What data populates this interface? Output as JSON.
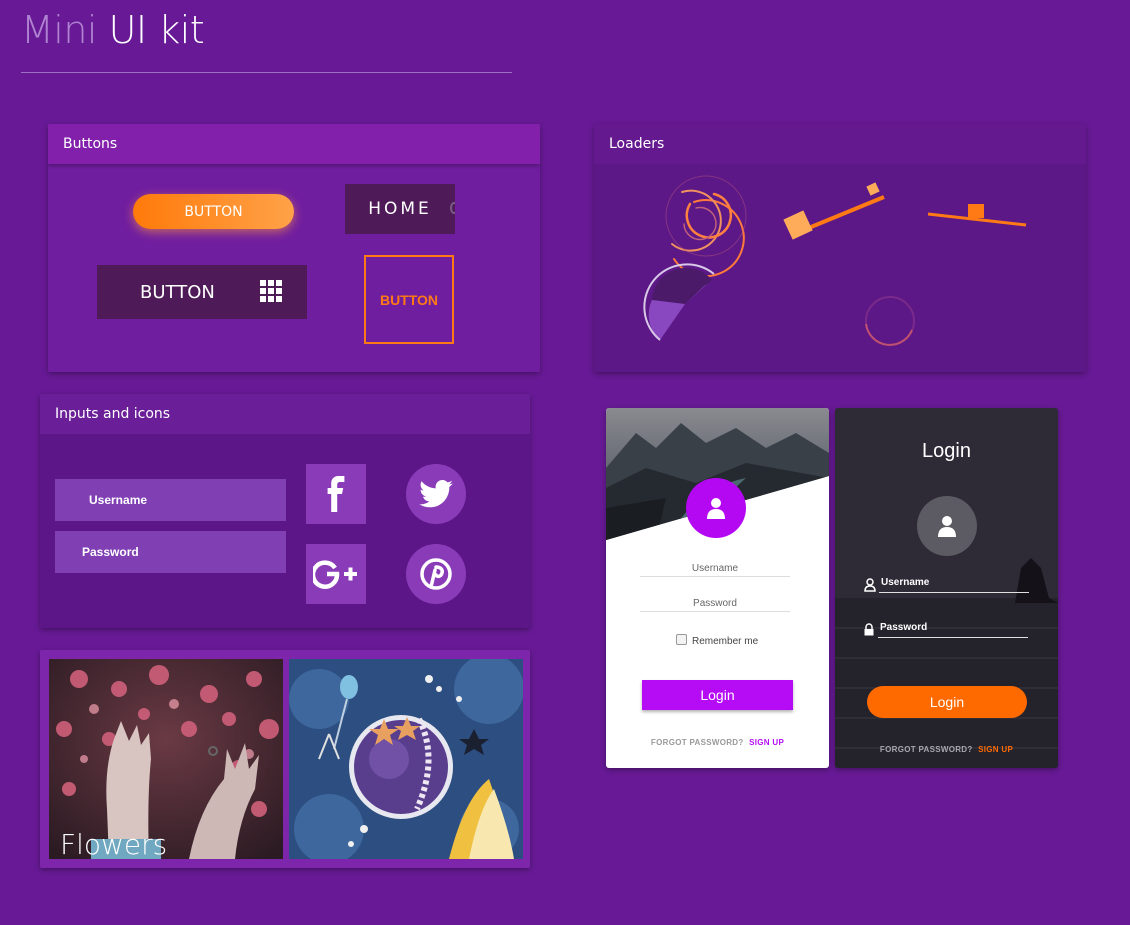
{
  "header": {
    "title_part1": "Mini",
    "title_part2": "UI kit"
  },
  "buttons_card": {
    "title": "Buttons",
    "pill_button": "BUTTON",
    "home_button": "HOME",
    "grid_button": "BUTTON",
    "outline_button": "BUTTON"
  },
  "loaders_card": {
    "title": "Loaders"
  },
  "inputs_card": {
    "title": "Inputs and icons",
    "username_placeholder": "Username",
    "password_placeholder": "Password",
    "social_icons": [
      "facebook-icon",
      "twitter-icon",
      "google-plus-icon",
      "pinterest-icon"
    ]
  },
  "images_card": {
    "flowers_label": "Flowers"
  },
  "login_light": {
    "username_placeholder": "Username",
    "password_placeholder": "Password",
    "remember_label": "Remember me",
    "login_button": "Login",
    "forgot_label": "FORGOT PASSWORD?",
    "signup_label": "SIGN UP"
  },
  "login_dark": {
    "title": "Login",
    "username_label": "Username",
    "password_label": "Password",
    "login_button": "Login",
    "forgot_label": "FORGOT PASSWORD?",
    "signup_label": "SIGN UP"
  },
  "colors": {
    "background": "#681a96",
    "accent_orange": "#ff6a00",
    "accent_purple": "#b50cf5"
  }
}
